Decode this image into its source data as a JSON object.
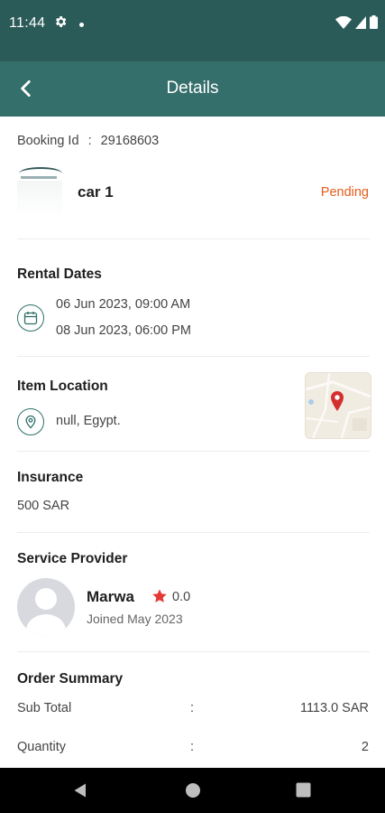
{
  "status": {
    "time": "11:44"
  },
  "header": {
    "title": "Details"
  },
  "booking": {
    "id_label": "Booking Id",
    "separator": ":",
    "id_value": "29168603",
    "item_name": "car 1",
    "status": "Pending",
    "status_color": "#e35d1c"
  },
  "rental_dates": {
    "title": "Rental Dates",
    "start": "06 Jun 2023, 09:00 AM",
    "end": "08 Jun 2023, 06:00 PM"
  },
  "item_location": {
    "title": "Item Location",
    "address": "null, Egypt."
  },
  "insurance": {
    "title": "Insurance",
    "amount": "500 SAR"
  },
  "provider": {
    "title": "Service Provider",
    "name": "Marwa",
    "rating": "0.0",
    "joined": "Joined May 2023"
  },
  "order_summary": {
    "title": "Order Summary",
    "rows": [
      {
        "label": "Sub Total",
        "sep": ":",
        "value": "1113.0 SAR"
      },
      {
        "label": "Quantity",
        "sep": ":",
        "value": "2"
      }
    ]
  },
  "colors": {
    "primary": "#356f6b",
    "status_bar": "#2a5b58",
    "accent_star": "#e53935",
    "map_pin": "#d32f2f"
  }
}
